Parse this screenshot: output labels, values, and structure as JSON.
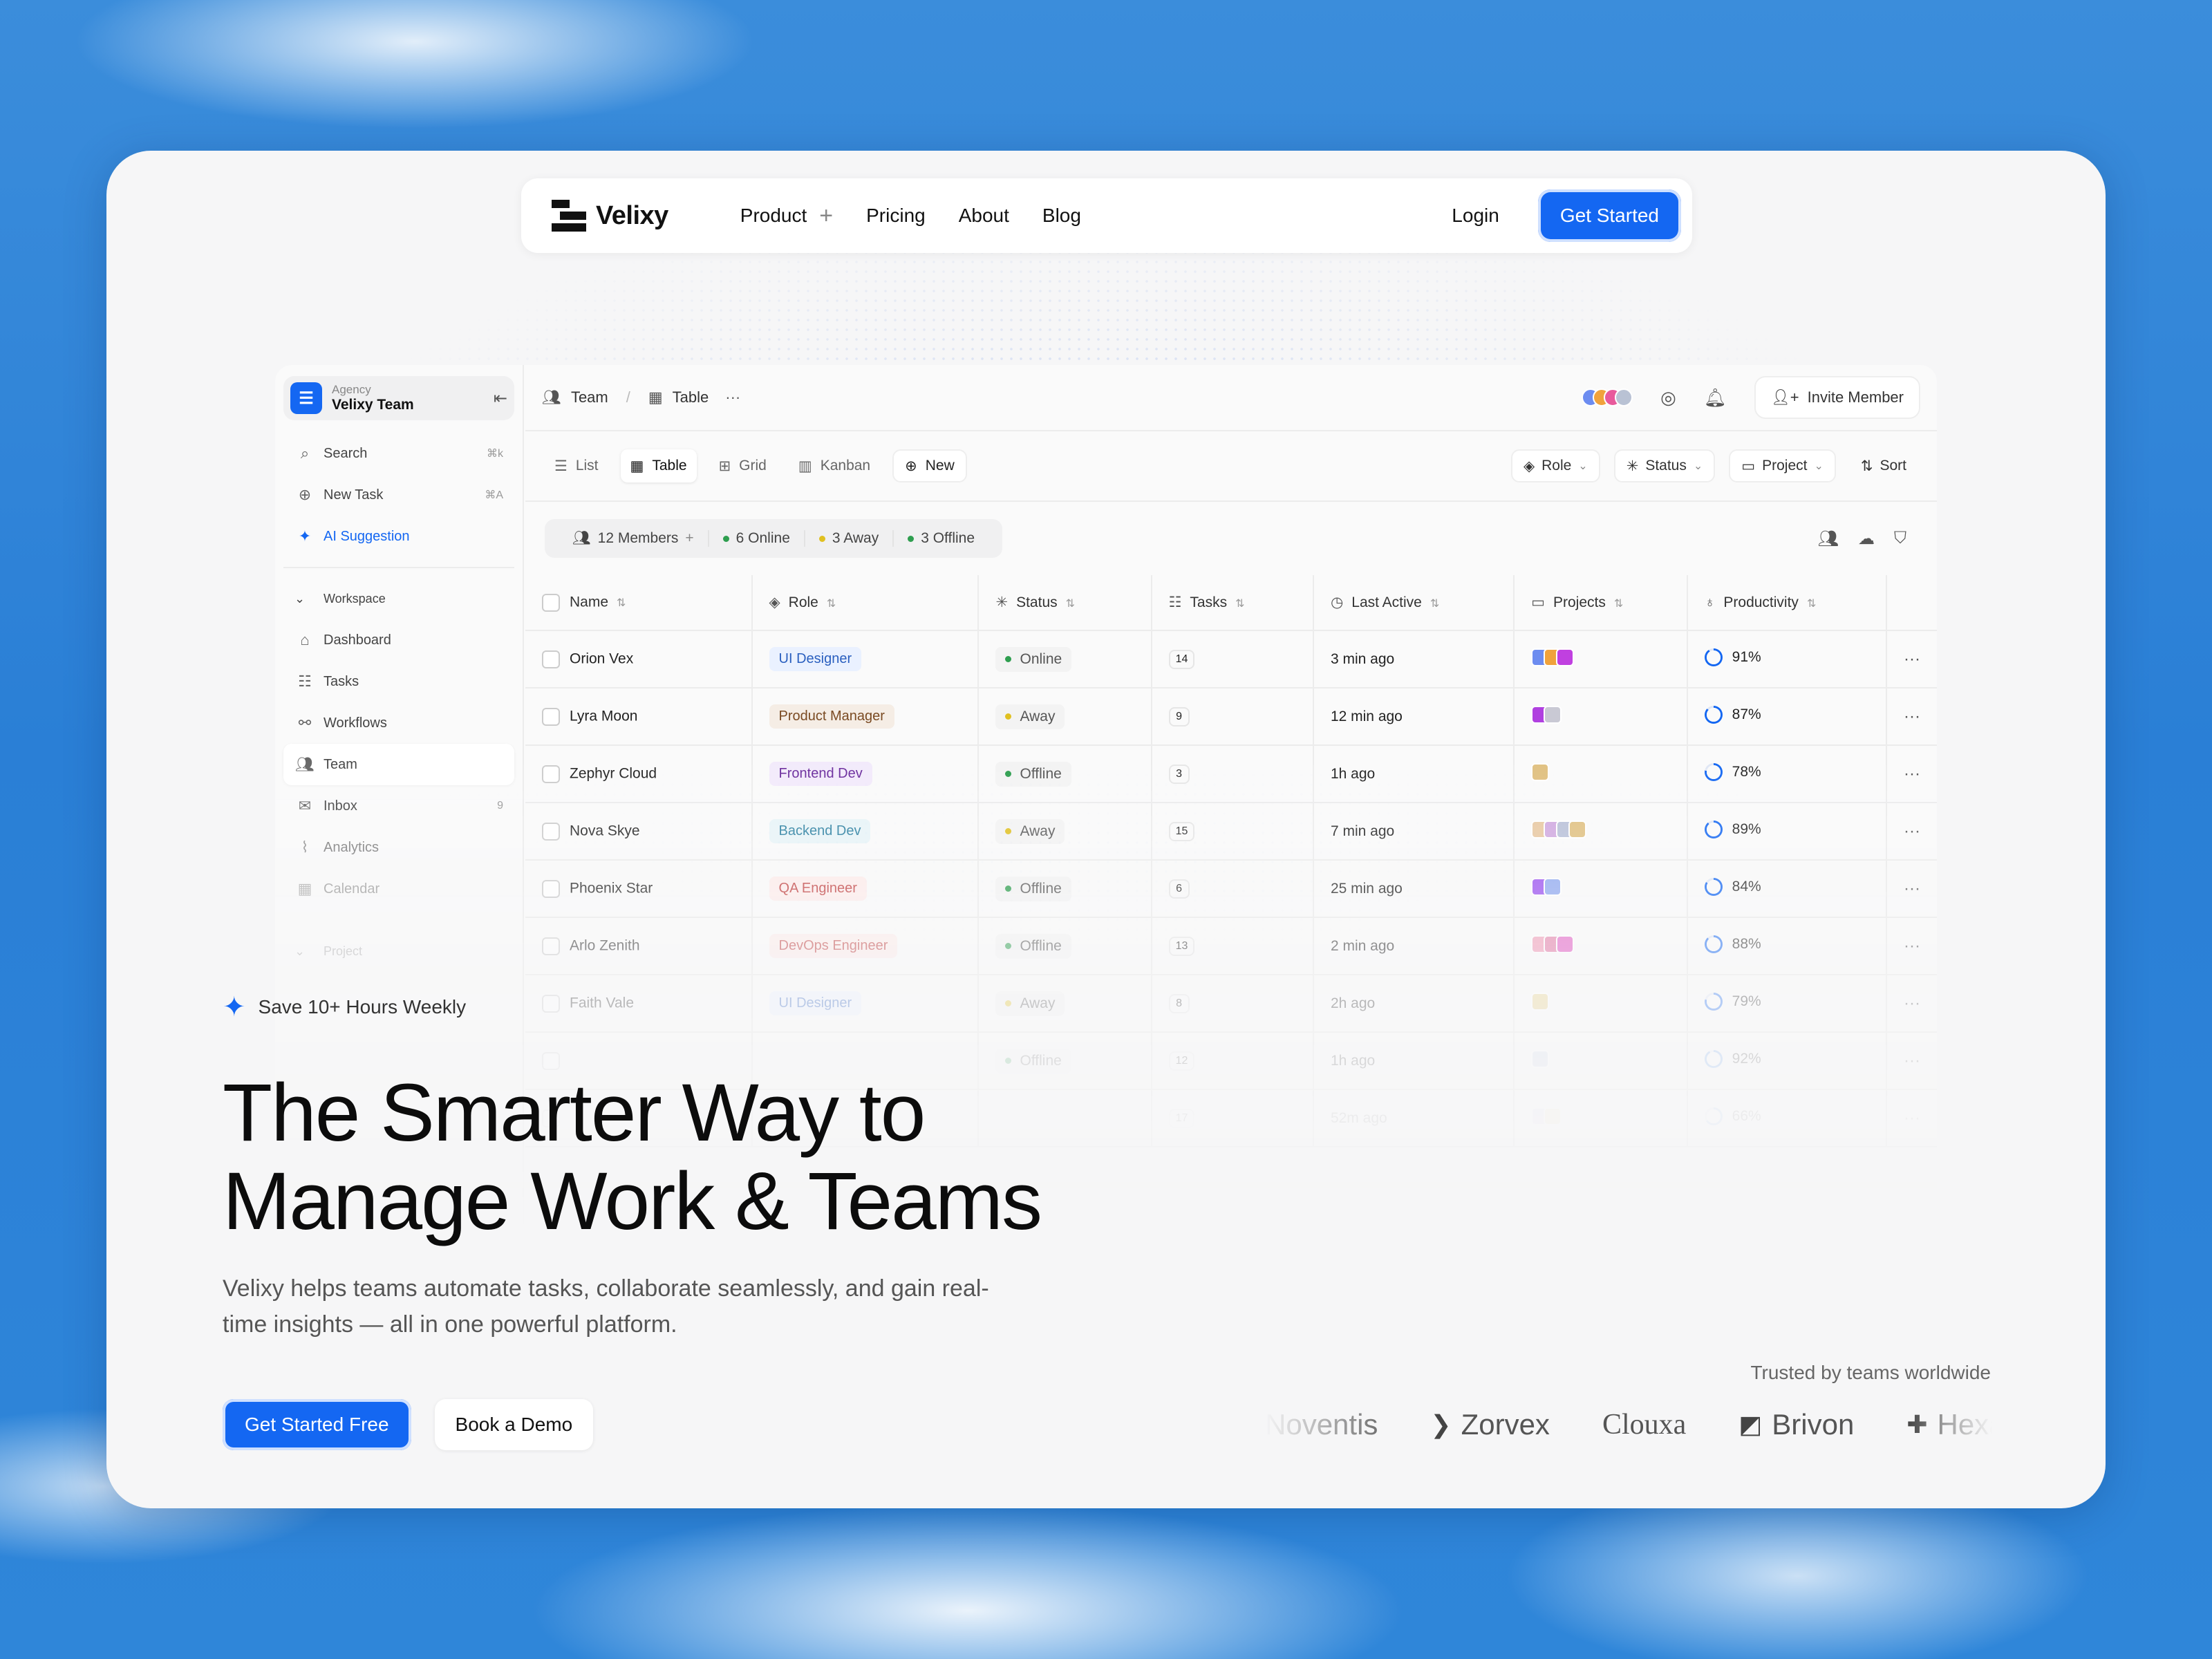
{
  "nav": {
    "brand": "Velixy",
    "links": [
      "Product",
      "Pricing",
      "About",
      "Blog"
    ],
    "product_plus": "+",
    "login": "Login",
    "cta": "Get Started"
  },
  "sidebar": {
    "org_small": "Agency",
    "org_name": "Velixy Team",
    "top_items": [
      {
        "label": "Search",
        "kbd": "⌘k",
        "icon": "search-icon"
      },
      {
        "label": "New Task",
        "kbd": "⌘A",
        "icon": "plus-circle-icon"
      },
      {
        "label": "AI Suggestion",
        "icon": "sparkle-icon"
      }
    ],
    "section": "Workspace",
    "items": [
      {
        "label": "Dashboard",
        "icon": "home-icon"
      },
      {
        "label": "Tasks",
        "icon": "tasks-icon"
      },
      {
        "label": "Workflows",
        "icon": "workflow-icon"
      },
      {
        "label": "Team",
        "icon": "team-icon"
      },
      {
        "label": "Inbox",
        "count": "9",
        "icon": "inbox-icon"
      },
      {
        "label": "Analytics",
        "icon": "analytics-icon"
      },
      {
        "label": "Calendar",
        "icon": "calendar-icon"
      }
    ],
    "section2": "Project"
  },
  "topbar": {
    "crumb1": "Team",
    "crumb2": "Table",
    "invite": "Invite Member"
  },
  "views": {
    "tabs": [
      "List",
      "Table",
      "Grid",
      "Kanban"
    ],
    "new": "New",
    "filters": [
      "Role",
      "Status",
      "Project"
    ],
    "sort": "Sort"
  },
  "stats": {
    "members": "12 Members",
    "online": "6 Online",
    "away": "3 Away",
    "offline": "3 Offline"
  },
  "table": {
    "headers": [
      "Name",
      "Role",
      "Status",
      "Tasks",
      "Last Active",
      "Projects",
      "Productivity"
    ],
    "rows": [
      {
        "name": "Orion Vex",
        "role": "UI Designer",
        "status": "Online",
        "tasks": "14",
        "last": "3 min ago",
        "prod": "91%"
      },
      {
        "name": "Lyra Moon",
        "role": "Product Manager",
        "status": "Away",
        "tasks": "9",
        "last": "12 min ago",
        "prod": "87%"
      },
      {
        "name": "Zephyr Cloud",
        "role": "Frontend Dev",
        "status": "Offline",
        "tasks": "3",
        "last": "1h ago",
        "prod": "78%"
      },
      {
        "name": "Nova Skye",
        "role": "Backend Dev",
        "status": "Away",
        "tasks": "15",
        "last": "7 min ago",
        "prod": "89%"
      },
      {
        "name": "Phoenix Star",
        "role": "QA Engineer",
        "status": "Offline",
        "tasks": "6",
        "last": "25 min ago",
        "prod": "84%"
      },
      {
        "name": "Arlo Zenith",
        "role": "DevOps Engineer",
        "status": "Offline",
        "tasks": "13",
        "last": "2 min ago",
        "prod": "88%"
      },
      {
        "name": "Faith Vale",
        "role": "UI Designer",
        "status": "Away",
        "tasks": "8",
        "last": "2h ago",
        "prod": "79%"
      },
      {
        "name": "",
        "role": "",
        "status": "Offline",
        "tasks": "12",
        "last": "1h ago",
        "prod": "92%"
      },
      {
        "name": "",
        "role": "",
        "status": "",
        "tasks": "17",
        "last": "52m ago",
        "prod": "66%"
      }
    ]
  },
  "hero": {
    "badge": "Save 10+ Hours Weekly",
    "headline1": "The Smarter Way to",
    "headline2": "Manage Work & Teams",
    "sub": "Velixy helps teams automate tasks, collaborate seamlessly, and gain real-time insights — all in one powerful platform.",
    "cta1": "Get Started Free",
    "cta2": "Book a Demo"
  },
  "trusted": {
    "label": "Trusted by teams worldwide",
    "logos": [
      "Noventis",
      "Zorvex",
      "Clouxa",
      "Brivon",
      "Hexar"
    ]
  },
  "colors": {
    "accent": "#1467f2",
    "online": "#2e9e4f",
    "away": "#e0c020",
    "offline": "#2e9e4f"
  }
}
